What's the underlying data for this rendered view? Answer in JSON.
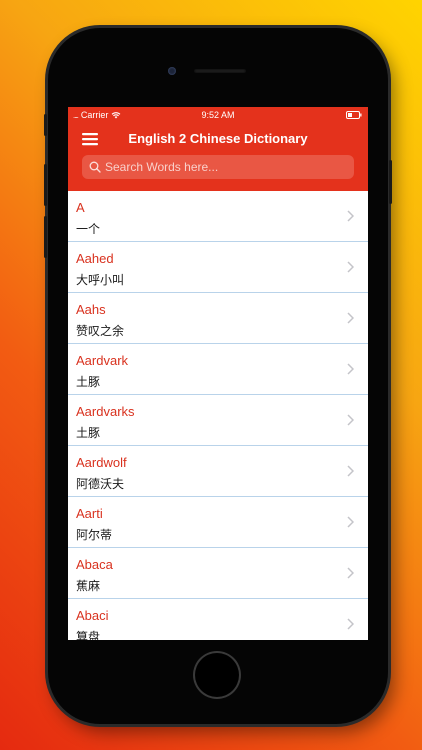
{
  "status_bar": {
    "signal": "....",
    "carrier": "Carrier",
    "time": "9:52 AM"
  },
  "nav": {
    "title": "English 2 Chinese Dictionary"
  },
  "search": {
    "placeholder": "Search Words here..."
  },
  "words": [
    {
      "en": "A",
      "zh": "一个"
    },
    {
      "en": "Aahed",
      "zh": "大呼小叫"
    },
    {
      "en": "Aahs",
      "zh": "赞叹之余"
    },
    {
      "en": "Aardvark",
      "zh": "土豚"
    },
    {
      "en": "Aardvarks",
      "zh": "土豚"
    },
    {
      "en": "Aardwolf",
      "zh": "阿德沃夫"
    },
    {
      "en": "Aarti",
      "zh": "阿尔蒂"
    },
    {
      "en": "Abaca",
      "zh": "蕉麻"
    },
    {
      "en": "Abaci",
      "zh": "算盘"
    }
  ],
  "colors": {
    "header": "#e4321c",
    "word_english": "#d9321f",
    "separator": "#b9d3ea"
  }
}
